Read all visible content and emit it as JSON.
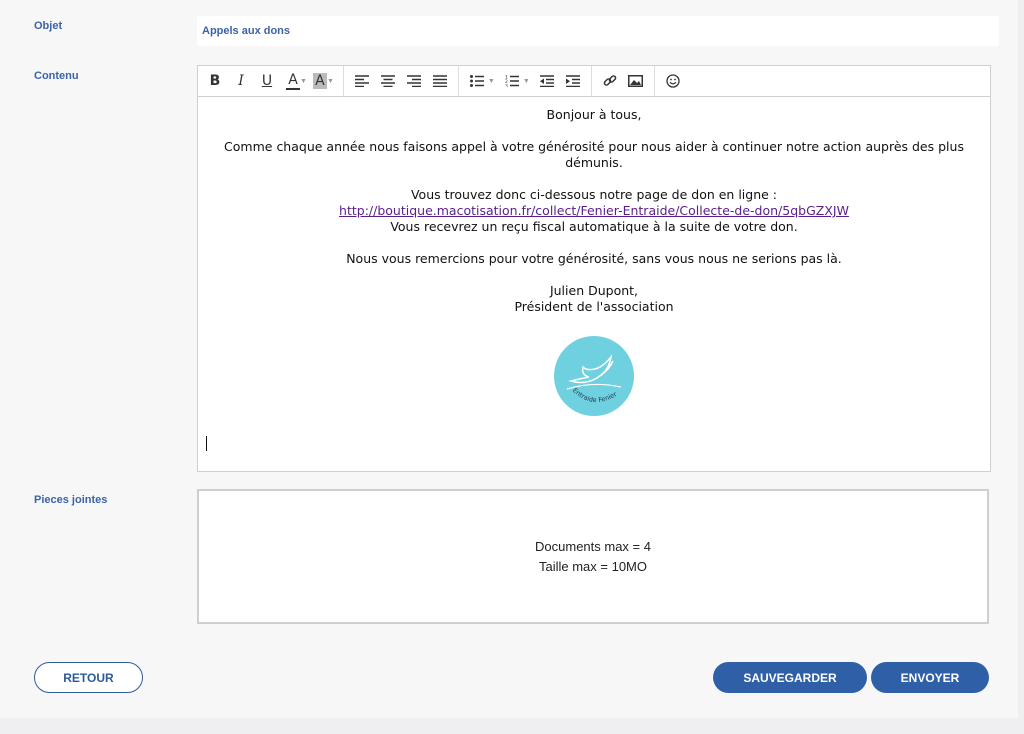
{
  "form": {
    "subject_label": "Objet",
    "subject_value": "Appels aux dons",
    "content_label": "Contenu",
    "attachments_label": "Pieces jointes"
  },
  "toolbar": {
    "icons": [
      "bold-icon",
      "italic-icon",
      "underline-icon",
      "font-color-icon",
      "background-color-icon",
      "align-left-icon",
      "align-center-icon",
      "align-right-icon",
      "align-justify-icon",
      "bullet-list-icon",
      "numbered-list-icon",
      "outdent-icon",
      "indent-icon",
      "link-icon",
      "image-icon",
      "emoji-icon"
    ]
  },
  "message": {
    "greeting": "Bonjour à tous,",
    "paragraph1": "Comme chaque année nous faisons appel à votre générosité pour nous aider à continuer notre action auprès des plus démunis.",
    "donation_intro": "Vous trouvez donc ci-dessous notre page de don en ligne :",
    "donation_link": "http://boutique.macotisation.fr/collect/Fenier-Entraide/Collecte-de-don/5qbGZXJW",
    "receipt": "Vous recevrez un reçu fiscal automatique à la suite de votre don.",
    "thanks": "Nous vous remercions pour votre générosité, sans vous nous ne serions pas là.",
    "signature_name": "Julien Dupont,",
    "signature_title": "Président de l'association",
    "logo_text": "Entraide Fenier",
    "logo_color": "#6fd0e0"
  },
  "attachments": {
    "max_docs": "Documents max = 4",
    "max_size": "Taille max = 10MO"
  },
  "buttons": {
    "back": "RETOUR",
    "save": "SAUVEGARDER",
    "send": "ENVOYER"
  },
  "colors": {
    "accent": "#2f5fa7",
    "label": "#3b63a8"
  }
}
